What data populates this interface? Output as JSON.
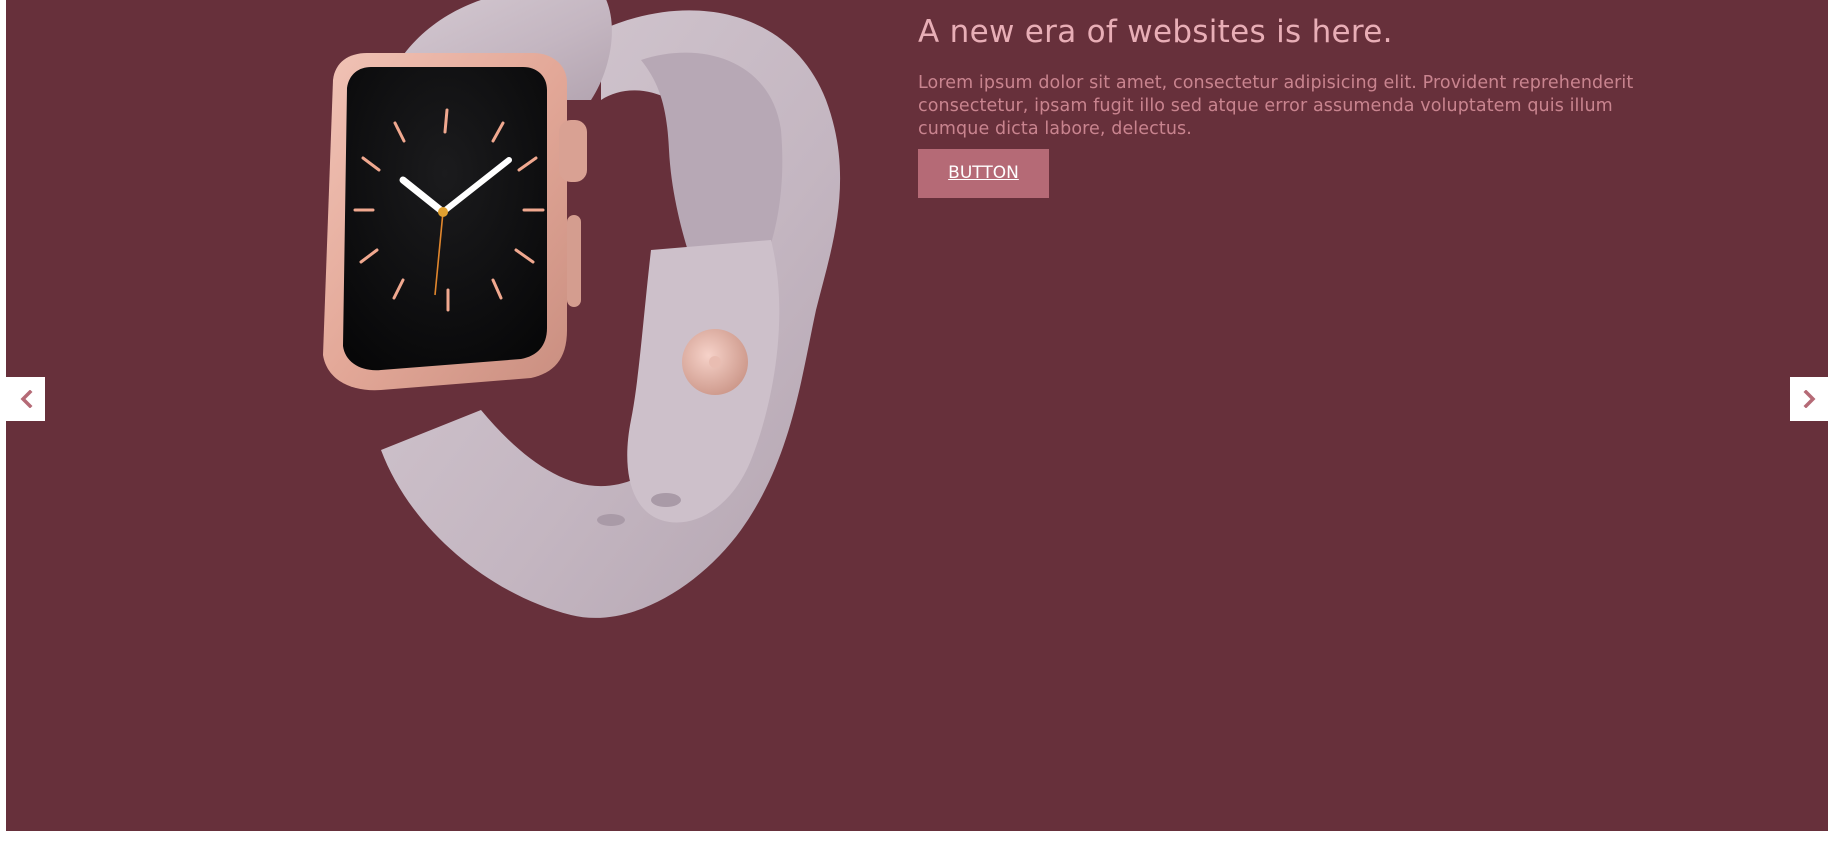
{
  "colors": {
    "background": "#67303b",
    "headline": "#e8aeb6",
    "body_text": "#c9848f",
    "button_bg": "#b56a76",
    "button_text": "#ffffff",
    "arrow_bg": "#ffffff",
    "arrow_icon": "#b56a76",
    "band": "#c9bcc6",
    "case": "#e0a89c"
  },
  "slide": {
    "headline": "A new era of websites is here.",
    "body": "Lorem ipsum dolor sit amet, consectetur adipisicing elit. Provident reprehenderit consectetur, ipsam fugit illo sed atque error assumenda voluptatem quis illum cumque dicta labore, delectus.",
    "button_label": "BUTTON"
  },
  "nav": {
    "prev_icon": "chevron-left-icon",
    "next_icon": "chevron-right-icon"
  },
  "product_image": {
    "icon": "smartwatch-image"
  }
}
